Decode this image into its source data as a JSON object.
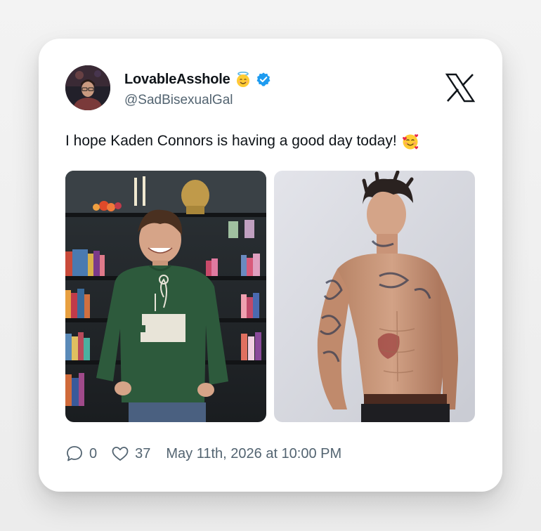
{
  "tweet": {
    "display_name": "LovableAsshole",
    "name_emoji": "smiling-face-with-halo",
    "verified": true,
    "handle": "@SadBisexualGal",
    "text": "I hope Kaden Connors is having a good day today!",
    "text_emoji": "smiling-face-with-hearts",
    "media": [
      {
        "icon": "photo-man-green-sweatshirt-bookshelf"
      },
      {
        "icon": "photo-shirtless-tattooed-man"
      }
    ],
    "replies": "0",
    "likes": "37",
    "timestamp": "May 11th, 2026 at 10:00 PM"
  },
  "colors": {
    "card_bg": "#ffffff",
    "page_bg": "#f2f2f2",
    "text_primary": "#0f1419",
    "text_secondary": "#536471",
    "verified_blue": "#1d9bf0"
  }
}
